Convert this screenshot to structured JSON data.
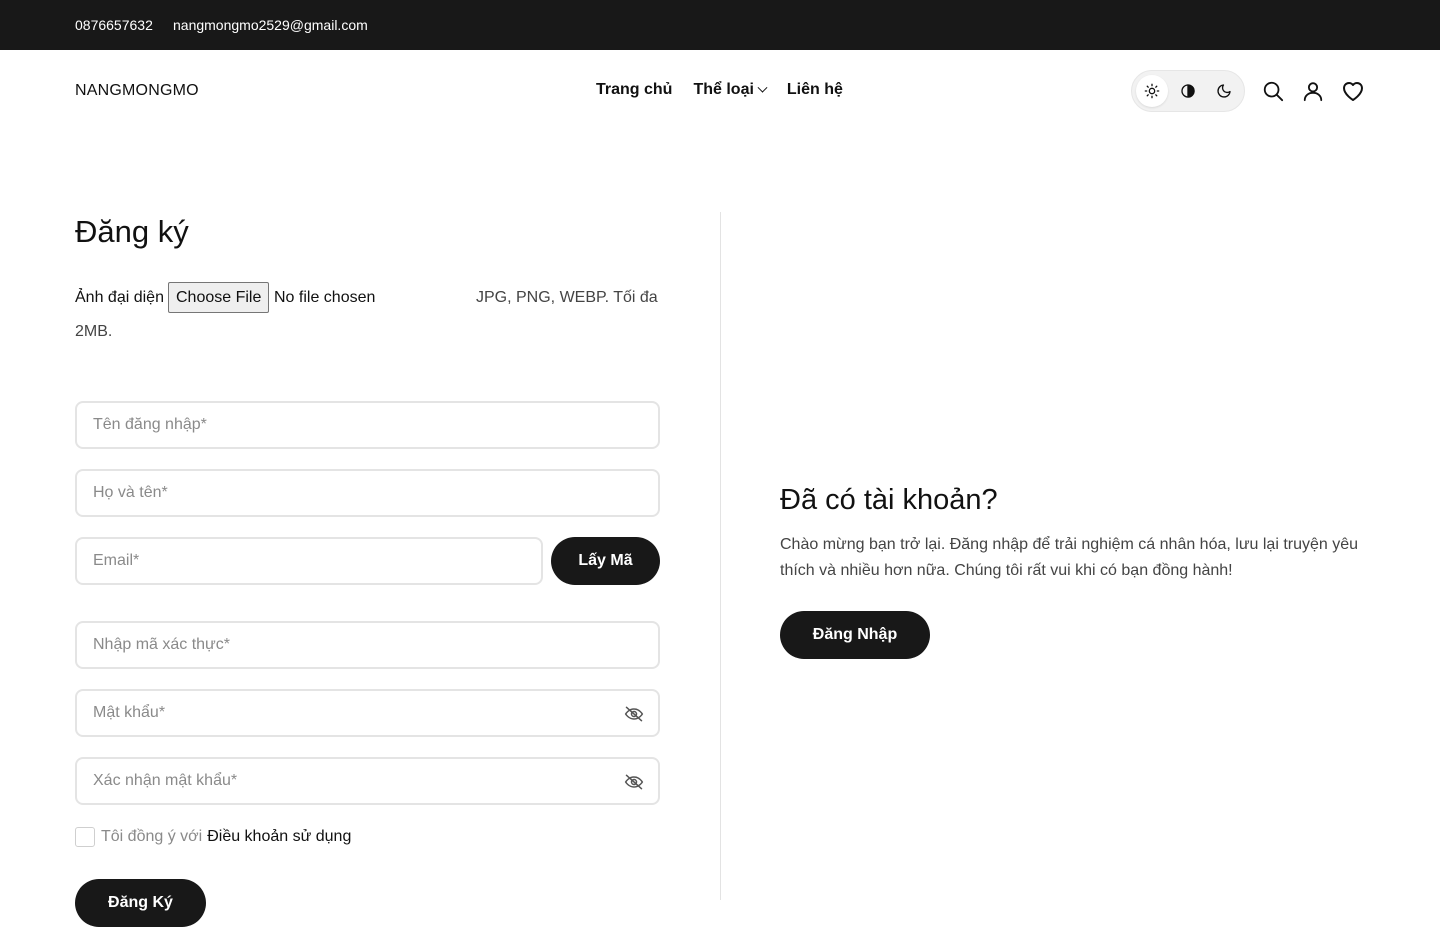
{
  "topbar": {
    "phone": "0876657632",
    "email": "nangmongmo2529@gmail.com"
  },
  "header": {
    "logo": "NANGMONGMO",
    "nav": [
      {
        "label": "Trang chủ"
      },
      {
        "label": "Thể loại",
        "icon": "chevron-down-icon"
      },
      {
        "label": "Liên hệ"
      }
    ],
    "theme_options": [
      "sun-icon",
      "contrast-icon",
      "moon-icon"
    ],
    "theme_active": "sun-icon",
    "icons": [
      "search-icon",
      "user-icon",
      "heart-icon"
    ]
  },
  "register": {
    "title": "Đăng ký",
    "avatar_label": "Ảnh đại diện",
    "choose_file": "Choose File",
    "no_file": "No file chosen",
    "file_hint": "JPG, PNG, WEBP. Tối đa",
    "file_hint_cont": "2MB.",
    "username_placeholder": "Tên đăng nhập*",
    "fullname_placeholder": "Họ và tên*",
    "email_placeholder": "Email*",
    "get_code_label": "Lấy Mã",
    "code_placeholder": "Nhập mã xác thực*",
    "password_placeholder": "Mật khẩu*",
    "confirm_placeholder": "Xác nhận mật khẩu*",
    "agree_text": "Tôi đồng ý với",
    "terms_link": "Điều khoản sử dụng",
    "submit_label": "Đăng Ký"
  },
  "login_panel": {
    "title": "Đã có tài khoản?",
    "description": "Chào mừng bạn trở lại. Đăng nhập để trải nghiệm cá nhân hóa, lưu lại truyện yêu thích và nhiều hơn nữa. Chúng tôi rất vui khi có bạn đồng hành!",
    "login_label": "Đăng Nhập"
  },
  "colors": {
    "topbar_bg": "#181818",
    "button_bg": "#181818",
    "border": "#e4e4e4"
  }
}
